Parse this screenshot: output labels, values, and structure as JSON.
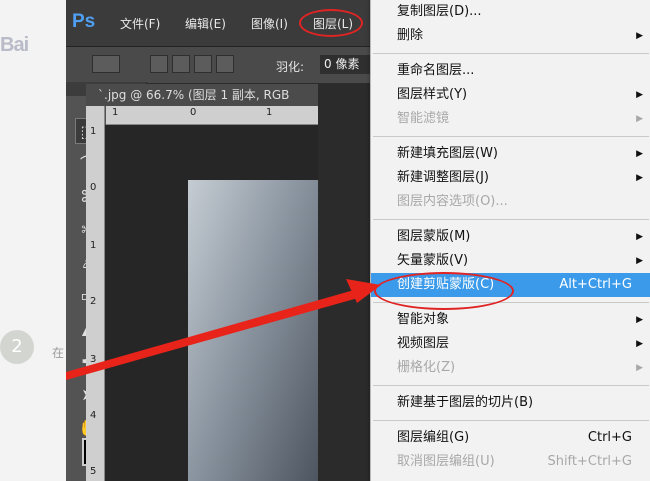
{
  "background": {
    "logo_text": "Bai",
    "step_number": "2",
    "step_text": "在"
  },
  "app": {
    "logo": "Ps",
    "menubar": [
      "文件(F)",
      "编辑(E)",
      "图像(I)",
      "图层(L)"
    ],
    "active_menu": "图层(L)",
    "options": {
      "feather_label": "羽化:",
      "feather_value": "0 像素"
    },
    "document_tab": "`.jpg @ 66.7% (图层 1 副本, RGB",
    "ruler_top": [
      "1",
      "0",
      "1"
    ],
    "ruler_left": [
      "1",
      "0",
      "1",
      "2",
      "3",
      "4",
      "5"
    ],
    "tools": [
      {
        "icon": "marquee-icon",
        "glyph": "⬚"
      },
      {
        "icon": "move-icon",
        "glyph": "✥"
      },
      {
        "icon": "lasso-icon",
        "glyph": "⌒"
      },
      {
        "icon": "quick-select-icon",
        "glyph": "✎"
      },
      {
        "icon": "crop-icon",
        "glyph": "⌘"
      },
      {
        "icon": "eyedropper-icon",
        "glyph": "✐"
      },
      {
        "icon": "healing-brush-icon",
        "glyph": "✂"
      },
      {
        "icon": "brush-icon",
        "glyph": "✏"
      },
      {
        "icon": "clone-stamp-icon",
        "glyph": "♙"
      },
      {
        "icon": "history-brush-icon",
        "glyph": "✍"
      },
      {
        "icon": "eraser-icon",
        "glyph": "▭"
      },
      {
        "icon": "gradient-icon",
        "glyph": "▤"
      },
      {
        "icon": "blur-icon",
        "glyph": "▲"
      },
      {
        "icon": "dodge-icon",
        "glyph": "●"
      },
      {
        "icon": "pen-icon",
        "glyph": "✒"
      },
      {
        "icon": "type-icon",
        "glyph": "T"
      },
      {
        "icon": "path-select-icon",
        "glyph": "➤"
      },
      {
        "icon": "ellipse-shape-icon",
        "glyph": "⬭"
      },
      {
        "icon": "hand-icon",
        "glyph": "✋"
      },
      {
        "icon": "zoom-icon",
        "glyph": "⌕"
      }
    ]
  },
  "layer_menu": [
    {
      "label": "复制图层(D)...",
      "shortcut": "",
      "submenu": false,
      "disabled": false,
      "highlighted": false
    },
    {
      "label": "删除",
      "shortcut": "",
      "submenu": true,
      "disabled": false,
      "highlighted": false
    },
    {
      "separator": true
    },
    {
      "label": "重命名图层...",
      "shortcut": "",
      "submenu": false,
      "disabled": false,
      "highlighted": false
    },
    {
      "label": "图层样式(Y)",
      "shortcut": "",
      "submenu": true,
      "disabled": false,
      "highlighted": false
    },
    {
      "label": "智能滤镜",
      "shortcut": "",
      "submenu": true,
      "disabled": true,
      "highlighted": false
    },
    {
      "separator": true
    },
    {
      "label": "新建填充图层(W)",
      "shortcut": "",
      "submenu": true,
      "disabled": false,
      "highlighted": false
    },
    {
      "label": "新建调整图层(J)",
      "shortcut": "",
      "submenu": true,
      "disabled": false,
      "highlighted": false
    },
    {
      "label": "图层内容选项(O)...",
      "shortcut": "",
      "submenu": false,
      "disabled": true,
      "highlighted": false
    },
    {
      "separator": true
    },
    {
      "label": "图层蒙版(M)",
      "shortcut": "",
      "submenu": true,
      "disabled": false,
      "highlighted": false
    },
    {
      "label": "矢量蒙版(V)",
      "shortcut": "",
      "submenu": true,
      "disabled": false,
      "highlighted": false
    },
    {
      "label": "创建剪贴蒙版(C)",
      "shortcut": "Alt+Ctrl+G",
      "submenu": false,
      "disabled": false,
      "highlighted": true
    },
    {
      "separator": true
    },
    {
      "label": "智能对象",
      "shortcut": "",
      "submenu": true,
      "disabled": false,
      "highlighted": false
    },
    {
      "label": "视频图层",
      "shortcut": "",
      "submenu": true,
      "disabled": false,
      "highlighted": false
    },
    {
      "label": "栅格化(Z)",
      "shortcut": "",
      "submenu": true,
      "disabled": true,
      "highlighted": false
    },
    {
      "separator": true
    },
    {
      "label": "新建基于图层的切片(B)",
      "shortcut": "",
      "submenu": false,
      "disabled": false,
      "highlighted": false
    },
    {
      "separator": true
    },
    {
      "label": "图层编组(G)",
      "shortcut": "Ctrl+G",
      "submenu": false,
      "disabled": false,
      "highlighted": false
    },
    {
      "label": "取消图层编组(U)",
      "shortcut": "Shift+Ctrl+G",
      "submenu": false,
      "disabled": true,
      "highlighted": false
    }
  ],
  "colors": {
    "highlight": "#3b9bea",
    "annotation_red": "#e02424",
    "ps_blue": "#4f9ff2"
  }
}
